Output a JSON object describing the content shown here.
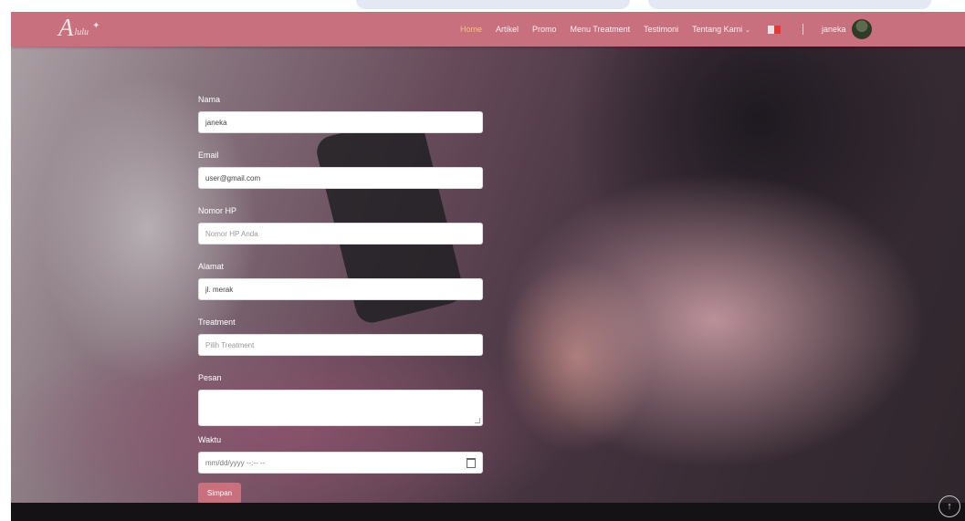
{
  "brand": {
    "logo_letter": "A",
    "logo_subtext": "lulu",
    "spark": "✦"
  },
  "nav": {
    "items": [
      {
        "label": "Home",
        "active": true
      },
      {
        "label": "Artikel"
      },
      {
        "label": "Promo"
      },
      {
        "label": "Menu Treatment"
      },
      {
        "label": "Testimoni"
      },
      {
        "label": "Tentang Kami",
        "dropdown": true
      }
    ],
    "caret": "⌄",
    "username": "janeka"
  },
  "form": {
    "nama": {
      "label": "Nama",
      "value": "janeka"
    },
    "email": {
      "label": "Email",
      "value": "user@gmail.com"
    },
    "hp": {
      "label": "Nomor HP",
      "placeholder": "Nomor HP Anda"
    },
    "alamat": {
      "label": "Alamat",
      "value": "jl. merak"
    },
    "treatment": {
      "label": "Treatment",
      "placeholder": "Pilih Treatment"
    },
    "pesan": {
      "label": "Pesan",
      "value": ""
    },
    "waktu": {
      "label": "Waktu",
      "placeholder": "mm/dd/yyyy --:-- --"
    },
    "submit_label": "Simpan"
  },
  "colors": {
    "primary": "#c8707e",
    "active_nav": "#f5c27d",
    "footer": "#141214"
  },
  "icons": {
    "back_to_top": "arrow-up-icon",
    "calendar": "calendar-icon",
    "flag": "flag-icon"
  },
  "back_to_top_glyph": "↑"
}
